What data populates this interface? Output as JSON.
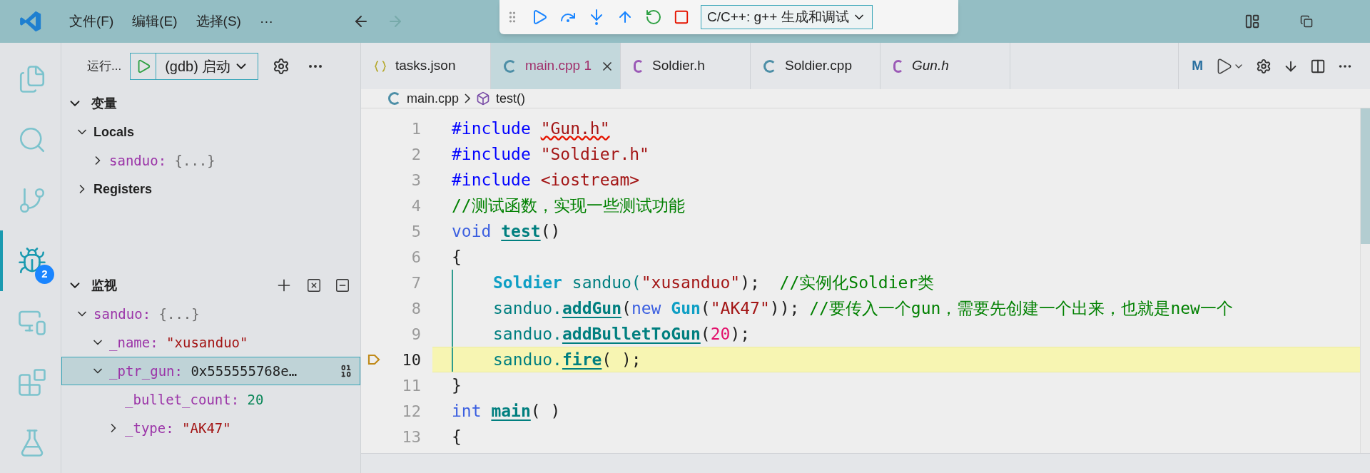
{
  "title_bar": {
    "menu": [
      "文件(F)",
      "编辑(E)",
      "选择(S)",
      "···"
    ]
  },
  "debug_toolbar": {
    "config": "C/C++: g++ 生成和调试"
  },
  "activity_bar": [
    {
      "kind": "explorer",
      "selected": false
    },
    {
      "kind": "search",
      "selected": false
    },
    {
      "kind": "source_control",
      "selected": false
    },
    {
      "kind": "debug",
      "selected": true,
      "badge": "2"
    },
    {
      "kind": "remote",
      "selected": false
    },
    {
      "kind": "extensions",
      "selected": false
    },
    {
      "kind": "testing",
      "selected": false
    }
  ],
  "sidebar": {
    "run_label": "运行...",
    "launch_config": "(gdb) 启动",
    "variables": {
      "title": "变量",
      "expanded": true,
      "children": [
        {
          "name": "Locals",
          "kind": "scope",
          "expanded": true,
          "children": [
            {
              "name": "sanduo:",
              "value": "{...}",
              "kind": "object",
              "expanded": false,
              "selected": false
            }
          ]
        },
        {
          "name": "Registers",
          "kind": "scope",
          "expanded": false
        }
      ]
    },
    "watch": {
      "title": "监视",
      "expanded": true,
      "children": [
        {
          "name": "sanduo:",
          "value": "{...}",
          "kind": "object",
          "expanded": true,
          "selected": false,
          "children": [
            {
              "name": "_name:",
              "value": "\"xusanduo\"",
              "kind": "string",
              "expanded": true,
              "selected": false
            },
            {
              "name": "_ptr_gun:",
              "value": "0x555555768e…",
              "kind": "pointer",
              "expanded": true,
              "selected": true,
              "children": [
                {
                  "name": "_bullet_count:",
                  "value": "20",
                  "kind": "number",
                  "selected": false
                },
                {
                  "name": "_type:",
                  "value": "\"AK47\"",
                  "kind": "string",
                  "expanded": false,
                  "selected": false
                }
              ]
            }
          ]
        }
      ]
    }
  },
  "tabs": [
    {
      "label": "tasks.json",
      "kind": "json",
      "selected": false,
      "preview": false
    },
    {
      "label": "main.cpp",
      "kind": "cpp",
      "selected": true,
      "preview": false,
      "problems": "1"
    },
    {
      "label": "Soldier.h",
      "kind": "h",
      "selected": false,
      "preview": false
    },
    {
      "label": "Soldier.cpp",
      "kind": "cpp",
      "selected": false,
      "preview": false
    },
    {
      "label": "Gun.h",
      "kind": "h",
      "selected": false,
      "preview": true
    }
  ],
  "editor_actions": {
    "makefile": "M"
  },
  "breadcrumb": [
    "main.cpp",
    "test()"
  ],
  "code": [
    {
      "number": "1",
      "current": false,
      "indent": false,
      "tokens": [
        {
          "t": "#include ",
          "kind": "macro"
        },
        {
          "t": "\"Gun.h\"",
          "kind": "string",
          "squiggle": true
        }
      ]
    },
    {
      "number": "2",
      "current": false,
      "indent": false,
      "tokens": [
        {
          "t": "#include ",
          "kind": "macro"
        },
        {
          "t": "\"Soldier.h\"",
          "kind": "string"
        }
      ]
    },
    {
      "number": "3",
      "current": false,
      "indent": false,
      "tokens": [
        {
          "t": "#include ",
          "kind": "macro"
        },
        {
          "t": "<iostream>",
          "kind": "string"
        }
      ]
    },
    {
      "number": "4",
      "current": false,
      "indent": false,
      "tokens": [
        {
          "t": "//测试函数，实现一些测试功能",
          "kind": "comment"
        }
      ]
    },
    {
      "number": "5",
      "current": false,
      "indent": false,
      "tokens": [
        {
          "t": "void ",
          "kind": "keyword"
        },
        {
          "t": "test",
          "kind": "function"
        },
        {
          "t": "()",
          "kind": "plain"
        }
      ]
    },
    {
      "number": "6",
      "current": false,
      "indent": false,
      "tokens": [
        {
          "t": "{",
          "kind": "plain"
        }
      ]
    },
    {
      "number": "7",
      "current": false,
      "indent": true,
      "tokens": [
        {
          "t": "Soldier",
          "kind": "type"
        },
        {
          "t": " sanduo(",
          "kind": "variable"
        },
        {
          "t": "\"xusanduo\"",
          "kind": "string"
        },
        {
          "t": ");  ",
          "kind": "plain"
        },
        {
          "t": "//实例化Soldier类",
          "kind": "comment"
        }
      ]
    },
    {
      "number": "8",
      "current": false,
      "indent": true,
      "tokens": [
        {
          "t": "sanduo.",
          "kind": "variable"
        },
        {
          "t": "addGun",
          "kind": "function"
        },
        {
          "t": "(",
          "kind": "plain"
        },
        {
          "t": "new ",
          "kind": "keyword"
        },
        {
          "t": "Gun",
          "kind": "type"
        },
        {
          "t": "(",
          "kind": "plain"
        },
        {
          "t": "\"AK47\"",
          "kind": "string"
        },
        {
          "t": ")); ",
          "kind": "plain"
        },
        {
          "t": "//要传入一个gun，需要先创建一个出来，也就是new一个",
          "kind": "comment"
        }
      ]
    },
    {
      "number": "9",
      "current": false,
      "indent": true,
      "tokens": [
        {
          "t": "sanduo.",
          "kind": "variable"
        },
        {
          "t": "addBulletToGun",
          "kind": "function"
        },
        {
          "t": "(",
          "kind": "plain"
        },
        {
          "t": "20",
          "kind": "number"
        },
        {
          "t": ");",
          "kind": "plain"
        }
      ]
    },
    {
      "number": "10",
      "current": true,
      "indent": true,
      "tokens": [
        {
          "t": "sanduo.",
          "kind": "variable"
        },
        {
          "t": "fire",
          "kind": "function"
        },
        {
          "t": "( );",
          "kind": "plain"
        }
      ]
    },
    {
      "number": "11",
      "current": false,
      "indent": false,
      "tokens": [
        {
          "t": "}",
          "kind": "plain"
        }
      ]
    },
    {
      "number": "12",
      "current": false,
      "indent": false,
      "tokens": [
        {
          "t": "int ",
          "kind": "keyword"
        },
        {
          "t": "main",
          "kind": "function"
        },
        {
          "t": "( )",
          "kind": "plain"
        }
      ]
    },
    {
      "number": "13",
      "current": false,
      "indent": false,
      "tokens": [
        {
          "t": "{",
          "kind": "plain"
        }
      ]
    }
  ]
}
